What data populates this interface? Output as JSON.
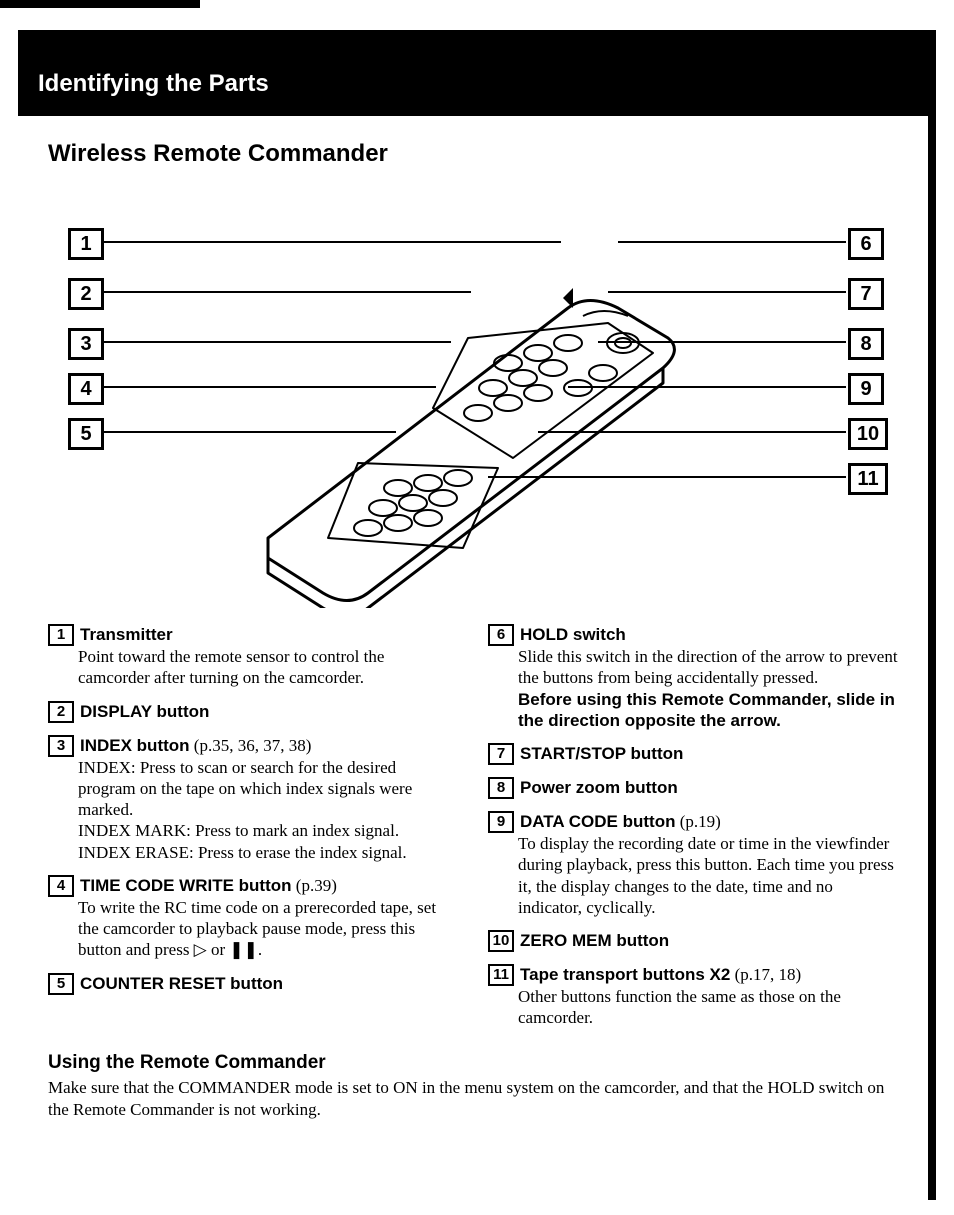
{
  "header": "Identifying the Parts",
  "section_title": "Wireless Remote Commander",
  "callouts_left": [
    "1",
    "2",
    "3",
    "4",
    "5"
  ],
  "callouts_right": [
    "6",
    "7",
    "8",
    "9",
    "10",
    "11"
  ],
  "left_items": [
    {
      "num": "1",
      "title": "Transmitter",
      "ref": "",
      "body": "Point toward the remote sensor to control the camcorder after turning on the camcorder."
    },
    {
      "num": "2",
      "title": "DISPLAY button",
      "ref": "",
      "body": ""
    },
    {
      "num": "3",
      "title": "INDEX button",
      "ref": " (p.35, 36, 37, 38)",
      "body": "INDEX: Press to scan or search for the desired program on the tape on which index signals were marked.\nINDEX MARK: Press to mark an index signal.\nINDEX ERASE: Press to erase the index signal."
    },
    {
      "num": "4",
      "title": "TIME CODE WRITE button",
      "ref": " (p.39)",
      "body": "To write the RC time code on a prerecorded tape, set the camcorder to playback pause mode, press this button and press ▷ or ❚❚."
    },
    {
      "num": "5",
      "title": "COUNTER RESET button",
      "ref": "",
      "body": ""
    }
  ],
  "right_items": [
    {
      "num": "6",
      "title": "HOLD switch",
      "ref": "",
      "body": "Slide this switch in the direction of the arrow to prevent the buttons from being accidentally pressed.",
      "bold_after": "Before using this Remote Commander, slide in the direction opposite the arrow."
    },
    {
      "num": "7",
      "title": "START/STOP button",
      "ref": "",
      "body": ""
    },
    {
      "num": "8",
      "title": "Power zoom button",
      "ref": "",
      "body": ""
    },
    {
      "num": "9",
      "title": "DATA CODE button",
      "ref": " (p.19)",
      "body": "To display the recording date or time in the viewfinder during playback, press this button. Each time you press it, the display changes to the date, time and no indicator, cyclically."
    },
    {
      "num": "10",
      "title": "ZERO MEM button",
      "ref": "",
      "body": ""
    },
    {
      "num": "11",
      "title": "Tape transport buttons X2",
      "ref": " (p.17, 18)",
      "body": "Other buttons function the same as those on the camcorder."
    }
  ],
  "footer": {
    "title": "Using the Remote Commander",
    "text": "Make sure that the COMMANDER mode is set to ON in the menu system on the camcorder, and that the HOLD switch on the Remote Commander is not working."
  }
}
